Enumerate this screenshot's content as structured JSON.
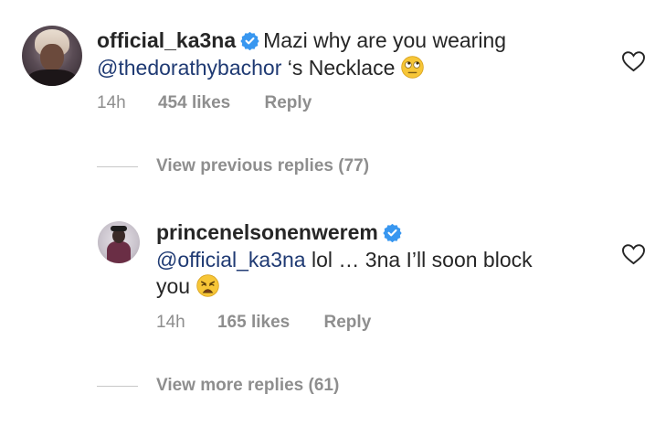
{
  "comments": [
    {
      "username": "official_ka3na",
      "text_pre": "Mazi why are you wearing",
      "mention": "@thedorathybachor",
      "text_post": " ‘s Necklace",
      "emoji": "🙄",
      "time": "14h",
      "likes": "454 likes",
      "reply": "Reply",
      "view_replies": "View previous replies (77)"
    },
    {
      "username": "princenelsonenwerem",
      "mention": "@official_ka3na",
      "text_post": " lol … 3na I’ll soon block",
      "text_line2": "you",
      "emoji": "😩",
      "time": "14h",
      "likes": "165 likes",
      "reply": "Reply",
      "view_replies": "View more replies (61)"
    }
  ],
  "colors": {
    "mention": "#1f3a73",
    "meta": "#8e8e8e",
    "verified": "#3897f0"
  },
  "icons": {
    "verified": "verified-badge-icon",
    "like": "heart-outline-icon"
  }
}
